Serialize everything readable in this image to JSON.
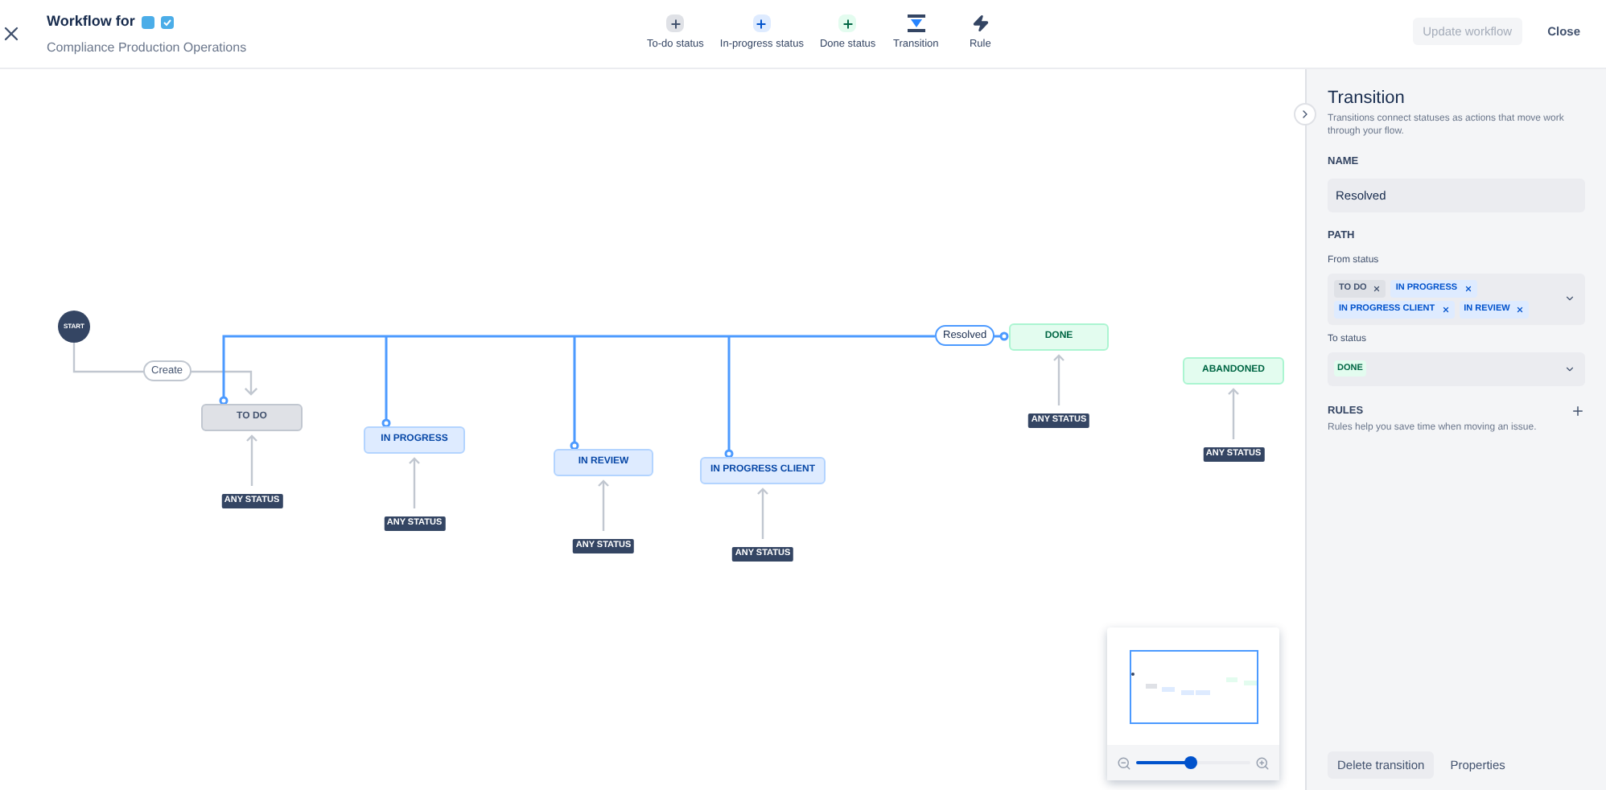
{
  "header": {
    "title": "Workflow for",
    "subtitle": "Compliance Production Operations"
  },
  "toolbar": [
    {
      "kind": "todo",
      "label": "To-do status"
    },
    {
      "kind": "inprogress",
      "label": "In-progress status"
    },
    {
      "kind": "done",
      "label": "Done status"
    },
    {
      "kind": "transition",
      "label": "Transition"
    },
    {
      "kind": "rule",
      "label": "Rule"
    }
  ],
  "actions": {
    "update": {
      "label": "Update workflow",
      "disabled": true
    },
    "close": "Close"
  },
  "canvas": {
    "start": "START",
    "statuses": [
      {
        "name": "TO DO",
        "kind": "todo",
        "global": "ANY STATUS"
      },
      {
        "name": "IN PROGRESS",
        "kind": "inprogress",
        "global": "ANY STATUS"
      },
      {
        "name": "IN REVIEW",
        "kind": "inprogress",
        "global": "ANY STATUS"
      },
      {
        "name": "IN PROGRESS CLIENT",
        "kind": "inprogress",
        "global": "ANY STATUS"
      },
      {
        "name": "DONE",
        "kind": "done",
        "global": "ANY STATUS"
      },
      {
        "name": "ABANDONED",
        "kind": "done",
        "global": "ANY STATUS"
      }
    ],
    "transitions": [
      {
        "label": "Create",
        "selected": false
      },
      {
        "label": "Resolved",
        "selected": true
      }
    ]
  },
  "minimap": {
    "zoom": {
      "level": 0.48
    }
  },
  "panel": {
    "title": "Transition",
    "description": "Transitions connect statuses as actions that move work through your flow.",
    "name_label": "NAME",
    "name_value": "Resolved",
    "path_label": "PATH",
    "from_label": "From status",
    "from": [
      {
        "name": "TO DO",
        "kind": "todo"
      },
      {
        "name": "IN PROGRESS",
        "kind": "inprogress"
      },
      {
        "name": "IN PROGRESS CLIENT",
        "kind": "inprogress"
      },
      {
        "name": "IN REVIEW",
        "kind": "inprogress"
      }
    ],
    "to_label": "To status",
    "to": {
      "name": "DONE",
      "kind": "done"
    },
    "rules_label": "RULES",
    "rules_hint": "Rules help you save time when moving an issue.",
    "buttons": [
      "Delete transition",
      "Properties"
    ]
  }
}
